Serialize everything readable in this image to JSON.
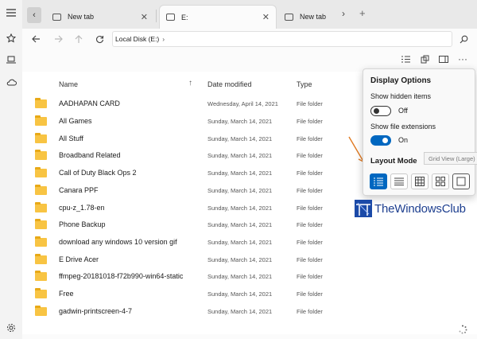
{
  "tabs": [
    {
      "label": "New tab"
    },
    {
      "label": "E:"
    },
    {
      "label": "New tab"
    }
  ],
  "address": {
    "path": "Local Disk (E:)"
  },
  "columns": {
    "name": "Name",
    "date": "Date modified",
    "type": "Type"
  },
  "rows": [
    {
      "name": "AADHAPAN CARD",
      "date": "Wednesday, April 14, 2021",
      "type": "File folder"
    },
    {
      "name": "All Games",
      "date": "Sunday, March 14, 2021",
      "type": "File folder"
    },
    {
      "name": "All Stuff",
      "date": "Sunday, March 14, 2021",
      "type": "File folder"
    },
    {
      "name": "Broadband Related",
      "date": "Sunday, March 14, 2021",
      "type": "File folder"
    },
    {
      "name": "Call of Duty Black Ops 2",
      "date": "Sunday, March 14, 2021",
      "type": "File folder"
    },
    {
      "name": "Canara PPF",
      "date": "Sunday, March 14, 2021",
      "type": "File folder"
    },
    {
      "name": "cpu-z_1.78-en",
      "date": "Sunday, March 14, 2021",
      "type": "File folder"
    },
    {
      "name": "Phone Backup",
      "date": "Sunday, March 14, 2021",
      "type": "File folder"
    },
    {
      "name": "download any windows 10 version gif",
      "date": "Sunday, March 14, 2021",
      "type": "File folder"
    },
    {
      "name": "E Drive Acer",
      "date": "Sunday, March 14, 2021",
      "type": "File folder"
    },
    {
      "name": "ffmpeg-20181018-f72b990-win64-static",
      "date": "Sunday, March 14, 2021",
      "type": "File folder"
    },
    {
      "name": "Free",
      "date": "Sunday, March 14, 2021",
      "type": "File folder"
    },
    {
      "name": "gadwin-printscreen-4-7",
      "date": "Sunday, March 14, 2021",
      "type": "File folder"
    }
  ],
  "display_options": {
    "title": "Display Options",
    "hidden_items_label": "Show hidden items",
    "hidden_items_state": "Off",
    "extensions_label": "Show file extensions",
    "extensions_state": "On",
    "layout_mode_label": "Layout Mode",
    "selected_layout": "details"
  },
  "tooltip": {
    "text": "Grid View (Large)"
  },
  "watermark": {
    "text": "TheWindowsClub"
  },
  "colors": {
    "accent": "#0067c0",
    "folder": "#f8c443"
  }
}
